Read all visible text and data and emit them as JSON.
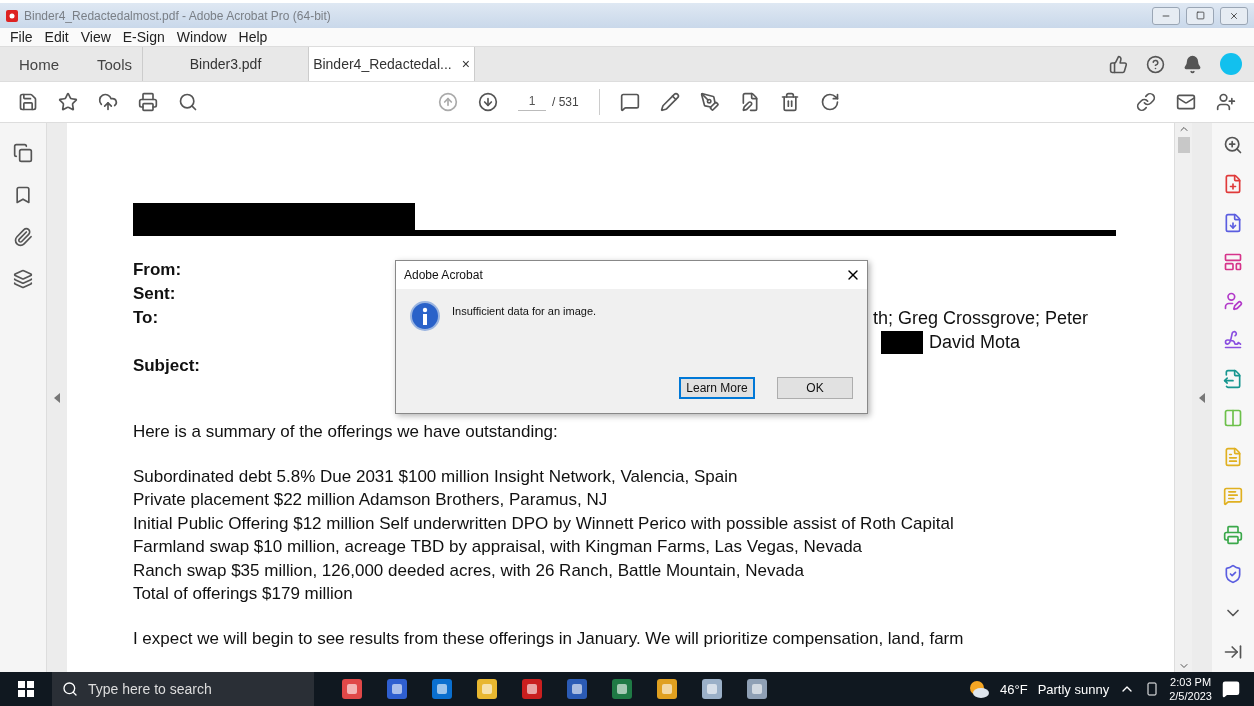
{
  "window": {
    "title": "Binder4_Redactedalmost.pdf - Adobe Acrobat Pro (64-bit)"
  },
  "menu": [
    "File",
    "Edit",
    "View",
    "E-Sign",
    "Window",
    "Help"
  ],
  "nav": [
    "Home",
    "Tools"
  ],
  "tabs": [
    {
      "label": "Binder3.pdf",
      "selected": false
    },
    {
      "label": "Binder4_Redactedal...",
      "selected": true,
      "close_glyph": "×"
    }
  ],
  "page_nav": {
    "current": "1",
    "total": "/ 531"
  },
  "document": {
    "header": [
      {
        "label": "From:"
      },
      {
        "label": "Sent:"
      },
      {
        "label": "To:",
        "lines": [
          {
            "text": "th; Greg Crossgrove; Peter",
            "redacted": false
          },
          {
            "text": "David Mota",
            "redacted": true
          }
        ]
      },
      {
        "label": "Subject:"
      }
    ],
    "intro": "Here is a summary of the offerings we have outstanding:",
    "offerings": [
      "Subordinated debt 5.8% Due 2031 $100 million Insight Network, Valencia, Spain",
      "Private placement $22 million Adamson Brothers, Paramus, NJ",
      "Initial Public Offering $12 million Self underwritten DPO by Winnett Perico with possible assist of Roth Capital",
      "Farmland swap $10 million, acreage TBD by appraisal, with Kingman Farms, Las Vegas, Nevada",
      "Ranch swap $35 million, 126,000 deeded acres, with 26 Ranch, Battle Mountain, Nevada",
      "Total of offerings $179 million"
    ],
    "closing": "I expect we will begin to see results from these offerings in January. We will prioritize compensation, land, farm"
  },
  "dialog": {
    "title": "Adobe Acrobat",
    "message": "Insufficient data for an image.",
    "buttons": [
      {
        "label": "Learn More",
        "focused": true
      },
      {
        "label": "OK",
        "focused": false
      }
    ]
  },
  "taskbar": {
    "search_placeholder": "Type here to search",
    "temperature": "46°F",
    "weather": "Partly sunny",
    "time": "2:03 PM",
    "date": "2/5/2023"
  }
}
